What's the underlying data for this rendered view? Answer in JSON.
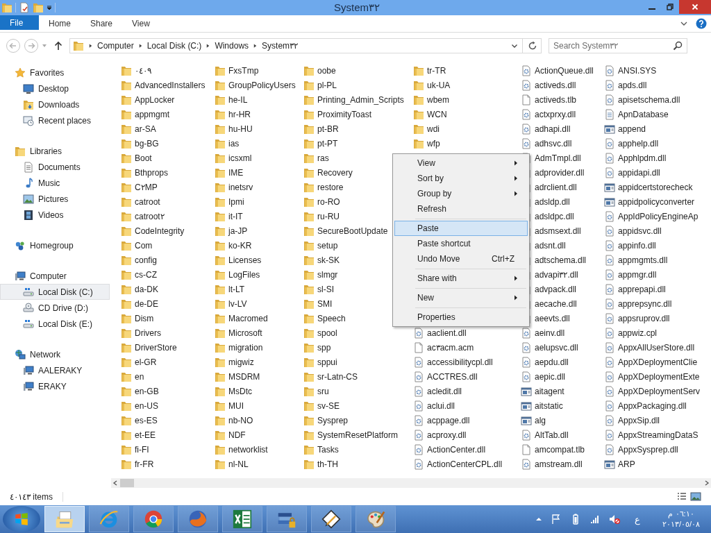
{
  "window": {
    "title": "System٣٢"
  },
  "ribbon": {
    "tabs": [
      {
        "label": "File",
        "kind": "file"
      },
      {
        "label": "Home",
        "kind": "tab"
      },
      {
        "label": "Share",
        "kind": "tab"
      },
      {
        "label": "View",
        "kind": "tab"
      }
    ]
  },
  "address_bar": {
    "crumbs": [
      "Computer",
      "Local Disk (C:)",
      "Windows",
      "System٣٢"
    ]
  },
  "search": {
    "placeholder": "Search System٣٢"
  },
  "sidebar": {
    "groups": [
      {
        "label": "Favorites",
        "kind": "star",
        "selected": false,
        "children": [
          {
            "label": "Desktop",
            "kind": "monitor",
            "selected": false
          },
          {
            "label": "Downloads",
            "kind": "downloads",
            "selected": false
          },
          {
            "label": "Recent places",
            "kind": "recent",
            "selected": false
          }
        ]
      },
      {
        "label": "Libraries",
        "kind": "library",
        "selected": false,
        "children": [
          {
            "label": "Documents",
            "kind": "document",
            "selected": false
          },
          {
            "label": "Music",
            "kind": "music",
            "selected": false
          },
          {
            "label": "Pictures",
            "kind": "pictures",
            "selected": false
          },
          {
            "label": "Videos",
            "kind": "film",
            "selected": false
          }
        ]
      },
      {
        "label": "Homegroup",
        "kind": "homegroup",
        "selected": false
      },
      {
        "label": "Computer",
        "kind": "computer",
        "selected": false,
        "children": [
          {
            "label": "Local Disk (C:)",
            "kind": "drive",
            "selected": true
          },
          {
            "label": "CD Drive (D:)",
            "kind": "cd",
            "selected": false
          },
          {
            "label": "Local Disk (E:)",
            "kind": "drive",
            "selected": false
          }
        ]
      },
      {
        "label": "Network",
        "kind": "network",
        "selected": false,
        "children": [
          {
            "label": "AALERAKY",
            "kind": "computer",
            "selected": false
          },
          {
            "label": "ERAKY",
            "kind": "computer",
            "selected": false
          }
        ]
      }
    ]
  },
  "files": {
    "columns": [
      {
        "items": [
          {
            "name": "٠٤٠٩",
            "kind": "folder"
          },
          {
            "name": "AdvancedInstallers",
            "kind": "folder"
          },
          {
            "name": "AppLocker",
            "kind": "folder"
          },
          {
            "name": "appmgmt",
            "kind": "folder"
          },
          {
            "name": "ar-SA",
            "kind": "folder"
          },
          {
            "name": "bg-BG",
            "kind": "folder"
          },
          {
            "name": "Boot",
            "kind": "folder"
          },
          {
            "name": "Bthprops",
            "kind": "folder"
          },
          {
            "name": "C٢MP",
            "kind": "folder"
          },
          {
            "name": "catroot",
            "kind": "folder"
          },
          {
            "name": "catroot٢",
            "kind": "folder"
          },
          {
            "name": "CodeIntegrity",
            "kind": "folder"
          },
          {
            "name": "Com",
            "kind": "folder"
          },
          {
            "name": "config",
            "kind": "folder"
          },
          {
            "name": "cs-CZ",
            "kind": "folder"
          },
          {
            "name": "da-DK",
            "kind": "folder"
          },
          {
            "name": "de-DE",
            "kind": "folder"
          },
          {
            "name": "Dism",
            "kind": "folder"
          },
          {
            "name": "Drivers",
            "kind": "folder"
          },
          {
            "name": "DriverStore",
            "kind": "folder"
          },
          {
            "name": "el-GR",
            "kind": "folder"
          },
          {
            "name": "en",
            "kind": "folder"
          },
          {
            "name": "en-GB",
            "kind": "folder"
          },
          {
            "name": "en-US",
            "kind": "folder"
          },
          {
            "name": "es-ES",
            "kind": "folder"
          },
          {
            "name": "et-EE",
            "kind": "folder"
          },
          {
            "name": "fi-FI",
            "kind": "folder"
          },
          {
            "name": "fr-FR",
            "kind": "folder"
          }
        ]
      },
      {
        "items": [
          {
            "name": "FxsTmp",
            "kind": "folder"
          },
          {
            "name": "GroupPolicyUsers",
            "kind": "folder"
          },
          {
            "name": "he-IL",
            "kind": "folder"
          },
          {
            "name": "hr-HR",
            "kind": "folder"
          },
          {
            "name": "hu-HU",
            "kind": "folder"
          },
          {
            "name": "ias",
            "kind": "folder"
          },
          {
            "name": "icsxml",
            "kind": "folder"
          },
          {
            "name": "IME",
            "kind": "folder"
          },
          {
            "name": "inetsrv",
            "kind": "folder"
          },
          {
            "name": "Ipmi",
            "kind": "folder"
          },
          {
            "name": "it-IT",
            "kind": "folder"
          },
          {
            "name": "ja-JP",
            "kind": "folder"
          },
          {
            "name": "ko-KR",
            "kind": "folder"
          },
          {
            "name": "Licenses",
            "kind": "folder"
          },
          {
            "name": "LogFiles",
            "kind": "folder"
          },
          {
            "name": "lt-LT",
            "kind": "folder"
          },
          {
            "name": "lv-LV",
            "kind": "folder"
          },
          {
            "name": "Macromed",
            "kind": "folder"
          },
          {
            "name": "Microsoft",
            "kind": "folder"
          },
          {
            "name": "migration",
            "kind": "folder"
          },
          {
            "name": "migwiz",
            "kind": "folder"
          },
          {
            "name": "MSDRM",
            "kind": "folder"
          },
          {
            "name": "MsDtc",
            "kind": "folder"
          },
          {
            "name": "MUI",
            "kind": "folder"
          },
          {
            "name": "nb-NO",
            "kind": "folder"
          },
          {
            "name": "NDF",
            "kind": "folder"
          },
          {
            "name": "networklist",
            "kind": "folder"
          },
          {
            "name": "nl-NL",
            "kind": "folder"
          }
        ]
      },
      {
        "items": [
          {
            "name": "oobe",
            "kind": "folder"
          },
          {
            "name": "pl-PL",
            "kind": "folder"
          },
          {
            "name": "Printing_Admin_Scripts",
            "kind": "folder"
          },
          {
            "name": "ProximityToast",
            "kind": "folder"
          },
          {
            "name": "pt-BR",
            "kind": "folder"
          },
          {
            "name": "pt-PT",
            "kind": "folder"
          },
          {
            "name": "ras",
            "kind": "folder"
          },
          {
            "name": "Recovery",
            "kind": "folder"
          },
          {
            "name": "restore",
            "kind": "folder"
          },
          {
            "name": "ro-RO",
            "kind": "folder"
          },
          {
            "name": "ru-RU",
            "kind": "folder"
          },
          {
            "name": "SecureBootUpdate",
            "kind": "folder"
          },
          {
            "name": "setup",
            "kind": "folder"
          },
          {
            "name": "sk-SK",
            "kind": "folder"
          },
          {
            "name": "slmgr",
            "kind": "folder"
          },
          {
            "name": "sl-SI",
            "kind": "folder"
          },
          {
            "name": "SMI",
            "kind": "folder"
          },
          {
            "name": "Speech",
            "kind": "folder"
          },
          {
            "name": "spool",
            "kind": "folder"
          },
          {
            "name": "spp",
            "kind": "folder"
          },
          {
            "name": "sppui",
            "kind": "folder"
          },
          {
            "name": "sr-Latn-CS",
            "kind": "folder"
          },
          {
            "name": "sru",
            "kind": "folder"
          },
          {
            "name": "sv-SE",
            "kind": "folder"
          },
          {
            "name": "Sysprep",
            "kind": "folder"
          },
          {
            "name": "SystemResetPlatform",
            "kind": "folder"
          },
          {
            "name": "Tasks",
            "kind": "folder"
          },
          {
            "name": "th-TH",
            "kind": "folder"
          }
        ]
      },
      {
        "items": [
          {
            "name": "tr-TR",
            "kind": "folder"
          },
          {
            "name": "uk-UA",
            "kind": "folder"
          },
          {
            "name": "wbem",
            "kind": "folder"
          },
          {
            "name": "WCN",
            "kind": "folder"
          },
          {
            "name": "wdi",
            "kind": "folder"
          },
          {
            "name": "wfp",
            "kind": "folder"
          }
        ],
        "items_below_menu": [
          {
            "name": "aaclient.dll",
            "kind": "dll"
          },
          {
            "name": "ac٣acm.acm",
            "kind": "blank"
          },
          {
            "name": "accessibilitycpl.dll",
            "kind": "dll"
          },
          {
            "name": "ACCTRES.dll",
            "kind": "dll"
          },
          {
            "name": "acledit.dll",
            "kind": "dll"
          },
          {
            "name": "aclui.dll",
            "kind": "dll"
          },
          {
            "name": "acppage.dll",
            "kind": "dll"
          },
          {
            "name": "acproxy.dll",
            "kind": "dll"
          },
          {
            "name": "ActionCenter.dll",
            "kind": "dll"
          },
          {
            "name": "ActionCenterCPL.dll",
            "kind": "dll"
          }
        ]
      },
      {
        "items": [
          {
            "name": "ActionQueue.dll",
            "kind": "dll"
          },
          {
            "name": "activeds.dll",
            "kind": "dll"
          },
          {
            "name": "activeds.tlb",
            "kind": "blank"
          },
          {
            "name": "actxprxy.dll",
            "kind": "dll"
          },
          {
            "name": "adhapi.dll",
            "kind": "dll"
          },
          {
            "name": "adhsvc.dll",
            "kind": "dll"
          },
          {
            "name": "AdmTmpl.dll",
            "kind": "dll"
          },
          {
            "name": "adprovider.dll",
            "kind": "dll"
          },
          {
            "name": "adrclient.dll",
            "kind": "dll"
          },
          {
            "name": "adsldp.dll",
            "kind": "dll"
          },
          {
            "name": "adsldpc.dll",
            "kind": "dll"
          },
          {
            "name": "adsmsext.dll",
            "kind": "dll"
          },
          {
            "name": "adsnt.dll",
            "kind": "dll"
          },
          {
            "name": "adtschema.dll",
            "kind": "dll"
          },
          {
            "name": "advapi٣٢.dll",
            "kind": "dll"
          },
          {
            "name": "advpack.dll",
            "kind": "dll"
          },
          {
            "name": "aecache.dll",
            "kind": "dll"
          },
          {
            "name": "aeevts.dll",
            "kind": "dll"
          },
          {
            "name": "aeinv.dll",
            "kind": "dll"
          },
          {
            "name": "aelupsvc.dll",
            "kind": "dll"
          },
          {
            "name": "aepdu.dll",
            "kind": "dll"
          },
          {
            "name": "aepic.dll",
            "kind": "dll"
          },
          {
            "name": "aitagent",
            "kind": "app"
          },
          {
            "name": "aitstatic",
            "kind": "app"
          },
          {
            "name": "alg",
            "kind": "app"
          },
          {
            "name": "AltTab.dll",
            "kind": "dll"
          },
          {
            "name": "amcompat.tlb",
            "kind": "blank"
          },
          {
            "name": "amstream.dll",
            "kind": "dll"
          }
        ]
      },
      {
        "items": [
          {
            "name": "ANSI.SYS",
            "kind": "dll"
          },
          {
            "name": "apds.dll",
            "kind": "dll"
          },
          {
            "name": "apisetschema.dll",
            "kind": "dll"
          },
          {
            "name": "ApnDatabase",
            "kind": "xml"
          },
          {
            "name": "append",
            "kind": "app"
          },
          {
            "name": "apphelp.dll",
            "kind": "dll"
          },
          {
            "name": "Apphlpdm.dll",
            "kind": "dll"
          },
          {
            "name": "appidapi.dll",
            "kind": "dll"
          },
          {
            "name": "appidcertstorecheck",
            "kind": "app"
          },
          {
            "name": "appidpolicyconverter",
            "kind": "app"
          },
          {
            "name": "AppIdPolicyEngineAp",
            "kind": "dll"
          },
          {
            "name": "appidsvc.dll",
            "kind": "dll"
          },
          {
            "name": "appinfo.dll",
            "kind": "dll"
          },
          {
            "name": "appmgmts.dll",
            "kind": "dll"
          },
          {
            "name": "appmgr.dll",
            "kind": "dll"
          },
          {
            "name": "apprepapi.dll",
            "kind": "dll"
          },
          {
            "name": "apprepsync.dll",
            "kind": "dll"
          },
          {
            "name": "appsruprov.dll",
            "kind": "dll"
          },
          {
            "name": "appwiz.cpl",
            "kind": "dll"
          },
          {
            "name": "AppxAllUserStore.dll",
            "kind": "dll"
          },
          {
            "name": "AppXDeploymentClie",
            "kind": "dll"
          },
          {
            "name": "AppXDeploymentExte",
            "kind": "dll"
          },
          {
            "name": "AppXDeploymentServ",
            "kind": "dll"
          },
          {
            "name": "AppxPackaging.dll",
            "kind": "dll"
          },
          {
            "name": "AppxSip.dll",
            "kind": "dll"
          },
          {
            "name": "AppxStreamingDataS",
            "kind": "dll"
          },
          {
            "name": "AppxSysprep.dll",
            "kind": "dll"
          },
          {
            "name": "ARP",
            "kind": "app"
          }
        ]
      }
    ]
  },
  "context_menu": {
    "items": [
      {
        "label": "View",
        "kind": "submenu",
        "selected": false
      },
      {
        "label": "Sort by",
        "kind": "submenu",
        "selected": false
      },
      {
        "label": "Group by",
        "kind": "submenu",
        "selected": false
      },
      {
        "label": "Refresh",
        "kind": "item",
        "selected": false
      },
      {
        "kind": "separator"
      },
      {
        "label": "Paste",
        "kind": "item",
        "selected": true
      },
      {
        "label": "Paste shortcut",
        "kind": "item",
        "selected": false
      },
      {
        "label": "Undo Move",
        "kind": "item",
        "shortcut": "Ctrl+Z",
        "selected": false
      },
      {
        "kind": "separator"
      },
      {
        "label": "Share with",
        "kind": "submenu",
        "selected": false
      },
      {
        "kind": "separator"
      },
      {
        "label": "New",
        "kind": "submenu",
        "selected": false
      },
      {
        "kind": "separator"
      },
      {
        "label": "Properties",
        "kind": "item",
        "selected": false
      }
    ]
  },
  "status_bar": {
    "count": "٤٠١٤٣ items"
  },
  "taskbar": {
    "apps": [
      {
        "kind": "folders",
        "selected": true
      },
      {
        "kind": "orbit",
        "selected": false
      },
      {
        "kind": "tricolor",
        "selected": false
      },
      {
        "kind": "globe",
        "selected": false
      },
      {
        "kind": "spreadsheet",
        "selected": false
      },
      {
        "kind": "books",
        "selected": false
      },
      {
        "kind": "drawing",
        "selected": false
      },
      {
        "kind": "palette",
        "selected": false
      }
    ],
    "language": "ع",
    "time": "٠٦:١٠ م",
    "date": "٢٠١٣/٠٥/٠٨"
  }
}
